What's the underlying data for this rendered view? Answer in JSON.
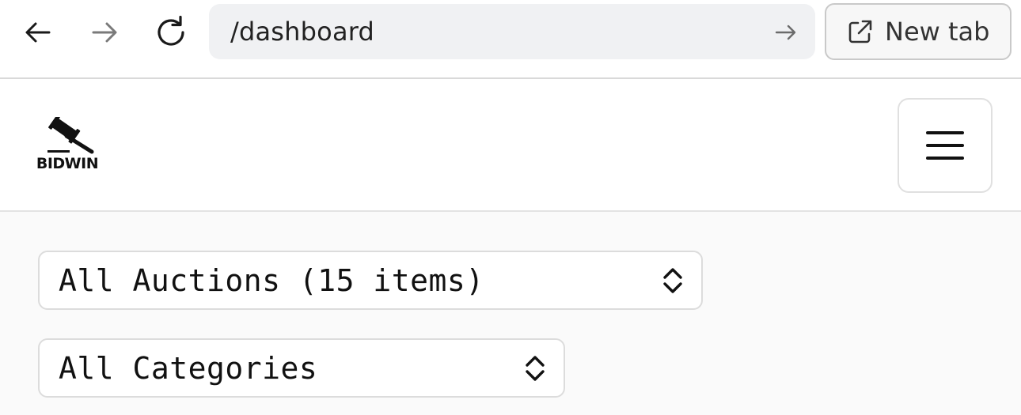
{
  "browser": {
    "url": "/dashboard",
    "new_tab_label": "New tab",
    "icons": {
      "back": "arrow-left-icon",
      "forward": "arrow-right-icon",
      "reload": "reload-icon",
      "go": "arrow-right-icon",
      "new_tab": "external-link-icon"
    }
  },
  "header": {
    "logo_text": "BIDWIN",
    "logo_icon": "gavel-icon",
    "menu_icon": "hamburger-menu-icon"
  },
  "filters": {
    "auctions_select": {
      "selected": "All Auctions (15 items)"
    },
    "categories_select": {
      "selected": "All Categories"
    }
  }
}
